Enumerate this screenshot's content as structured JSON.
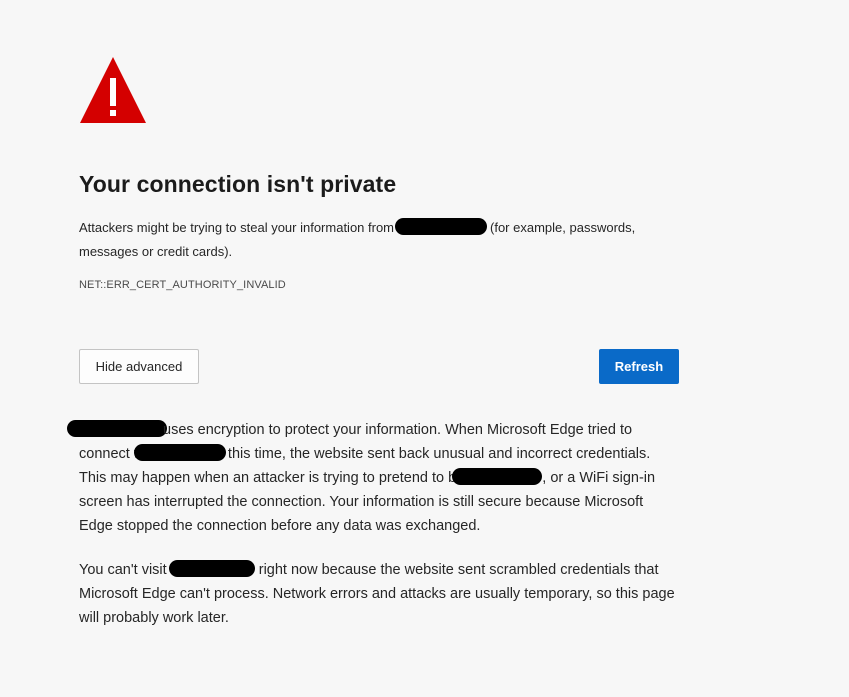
{
  "page": {
    "title": "Your connection isn't private",
    "summary_before": "Attackers might be trying to steal your information from",
    "summary_after": "(for example, passwords, messages or credit cards).",
    "error_code": "NET::ERR_CERT_AUTHORITY_INVALID"
  },
  "buttons": {
    "hide_advanced": "Hide advanced",
    "refresh": "Refresh"
  },
  "details": {
    "p1_a": "uses encryption to protect your information. When Microsoft Edge tried to connect to",
    "p1_b": "this time, the website sent back unusual and incorrect credentials. This may happen when an attacker is trying to pretend to be",
    "p1_c": ", or a WiFi sign-in screen has interrupted the connection. Your information is still secure because Microsoft Edge stopped the connection before any data was exchanged.",
    "p2_a": "You can't visit",
    "p2_b": "right now because the website sent scrambled credentials that Microsoft Edge can't process. Network errors and attacks are usually temporary, so this page will probably work later."
  },
  "colors": {
    "warning_red": "#d40000",
    "accent_blue": "#0a6ac8",
    "background": "#f7f7f7"
  },
  "icons": {
    "warning": "warning-triangle-icon"
  }
}
